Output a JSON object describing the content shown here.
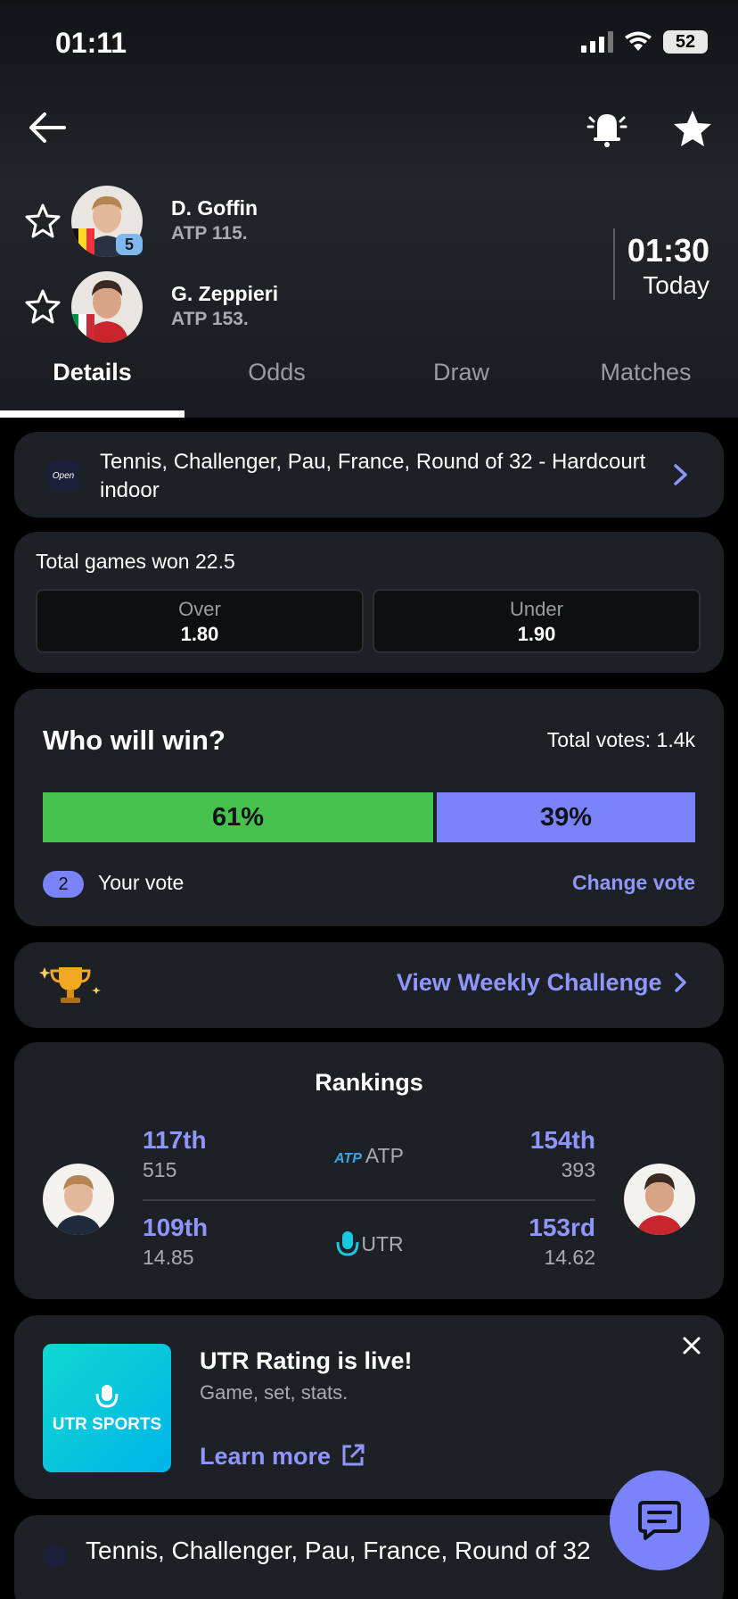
{
  "status": {
    "time": "01:11",
    "battery": "52"
  },
  "players": [
    {
      "name": "D. Goffin",
      "rank": "ATP 115.",
      "seed": "5"
    },
    {
      "name": "G. Zeppieri",
      "rank": "ATP 153."
    }
  ],
  "match": {
    "time": "01:30",
    "day": "Today"
  },
  "tabs": [
    "Details",
    "Odds",
    "Draw",
    "Matches"
  ],
  "tournament": {
    "text": "Tennis, Challenger, Pau, France, Round of 32 - Hardcourt indoor",
    "logo_text": "Open"
  },
  "odds": {
    "title": "Total games won 22.5",
    "over_label": "Over",
    "over_value": "1.80",
    "under_label": "Under",
    "under_value": "1.90"
  },
  "vote": {
    "title": "Who will win?",
    "total": "Total votes: 1.4k",
    "player1_pct": "61%",
    "player2_pct": "39%",
    "player1_share": 0.61,
    "your_vote_badge": "2",
    "your_vote_label": "Your vote",
    "change_label": "Change vote"
  },
  "challenge": {
    "link": "View Weekly Challenge"
  },
  "rankings": {
    "title": "Rankings",
    "rows": [
      {
        "label": "ATP",
        "left_rank": "117th",
        "left_pts": "515",
        "right_rank": "154th",
        "right_pts": "393"
      },
      {
        "label": "UTR",
        "left_rank": "109th",
        "left_pts": "14.85",
        "right_rank": "153rd",
        "right_pts": "14.62"
      }
    ]
  },
  "promo": {
    "title": "UTR Rating is live!",
    "subtitle": "Game, set, stats.",
    "link": "Learn more",
    "image_text": "UTR SPORTS"
  },
  "bottom": {
    "text": "Tennis, Challenger, Pau, France, Round of 32"
  },
  "colors": {
    "accent": "#7b83fb",
    "green": "#47c24f",
    "card": "#1d2024"
  }
}
